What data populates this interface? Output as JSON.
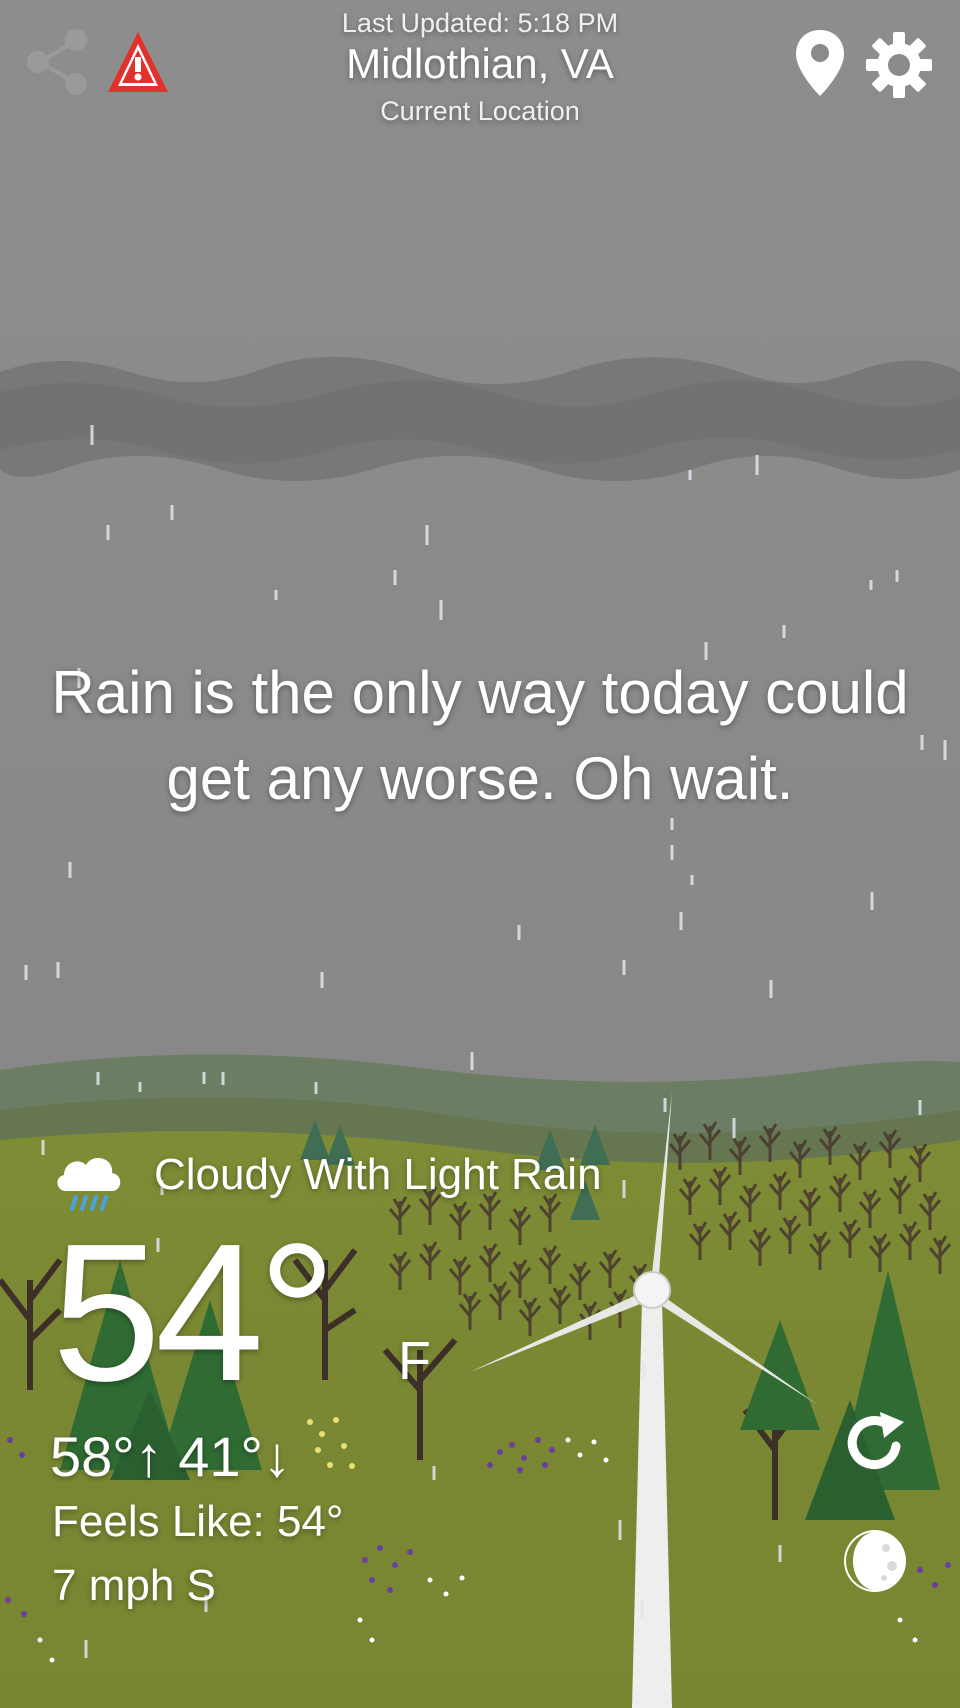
{
  "header": {
    "last_updated": "Last Updated: 5:18 PM",
    "city": "Midlothian, VA",
    "location_label": "Current Location",
    "icons": [
      "share-icon",
      "alert-icon",
      "location-pin-icon",
      "settings-gear-icon"
    ]
  },
  "message": "Rain is the only way today could get any worse. Oh wait.",
  "weather": {
    "condition": "Cloudy With Light Rain",
    "condition_icon": "cloud-rain-icon",
    "temperature": "54°",
    "unit": "F",
    "hi_lo": "58°↑ 41°↓",
    "feels_like": "Feels Like: 54°",
    "wind": "7 mph S"
  },
  "actions": {
    "icons": [
      "refresh-icon",
      "moon-phase-icon"
    ]
  },
  "colors": {
    "sky": "#8a8a8a",
    "cloud_band": "#727272",
    "grass": "#7c8a33",
    "hills": "#6b7d62",
    "alert_red": "#e0312a",
    "pine": "#2f6b33"
  }
}
